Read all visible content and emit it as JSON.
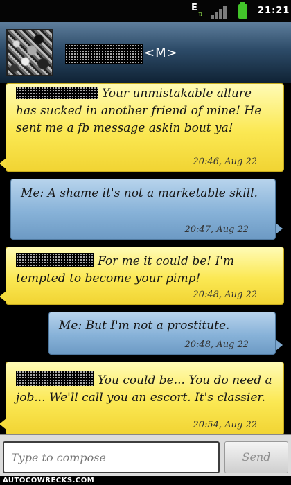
{
  "status_bar": {
    "network_type": "E",
    "network_arrows": "⇅",
    "signal_icon": "signal-bars-icon",
    "battery_icon": "battery-icon",
    "time": "21:21"
  },
  "header": {
    "contact_suffix": "<M>",
    "contact_name_redacted": true
  },
  "messages": [
    {
      "direction": "incoming",
      "sender_redacted": true,
      "text": "Your unmistakable allure has sucked in another friend of mine! He sent me a fb message askin bout ya!",
      "time": "20:46, Aug 22"
    },
    {
      "direction": "outgoing",
      "text": "Me: A shame it's not a marketable skill.",
      "time": "20:47, Aug 22"
    },
    {
      "direction": "incoming",
      "sender_redacted": true,
      "text": "For me it could be! I'm tempted to become your pimp!",
      "time": "20:48, Aug 22"
    },
    {
      "direction": "outgoing",
      "text": "Me: But I'm not a prostitute.",
      "time": "20:48, Aug 22"
    },
    {
      "direction": "incoming",
      "sender_redacted": true,
      "text": "You could be... You do need a job... We'll call you an escort. It's classier.",
      "time": "20:54, Aug 22"
    }
  ],
  "compose": {
    "placeholder": "Type to compose",
    "value": "",
    "send_label": "Send"
  },
  "watermark": {
    "text": "AUTOCOWRECKS.COM"
  },
  "colors": {
    "incoming_bubble": "#fbe853",
    "outgoing_bubble": "#87b2d8",
    "header": "#2d4b68"
  }
}
